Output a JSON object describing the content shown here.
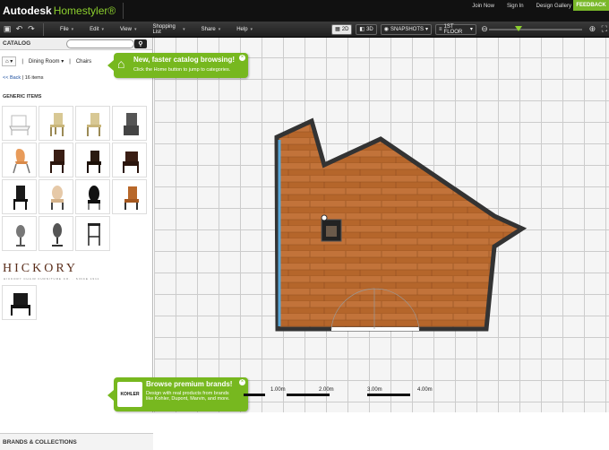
{
  "app": {
    "brand": "Autodesk",
    "brand_sub": "Homestyler®"
  },
  "toplinks": [
    "Join Now",
    "Sign In",
    "Design Gallery"
  ],
  "feedback": "FEEDBACK",
  "menu": [
    "File",
    "Edit",
    "View",
    "Shopping List",
    "Share",
    "Help"
  ],
  "view": {
    "view2d": "2D",
    "view3d": "3D",
    "snapshots": "SNAPSHOTS",
    "floor": "1ST FLOOR"
  },
  "sidebar": {
    "title": "CATALOG",
    "search_placeholder": "",
    "crumbs": [
      "Dining Room",
      "Chairs"
    ],
    "back": "<< Back",
    "count": "16 items",
    "section": "GENERIC ITEMS",
    "brand": "HICKORY",
    "brand_sub": "HICKORY CHAIR FURNITURE CO. · SINCE 1911",
    "footer": "BRANDS & COLLECTIONS"
  },
  "tip1": {
    "title": "New, faster catalog browsing!",
    "body": "Click the Home button to jump to categories."
  },
  "tip2": {
    "logo": "KOHLER",
    "title": "Browse premium brands!",
    "body": "Design with real products from brands like Kohler, Dupont, Marvin, and more."
  },
  "scale": [
    "1.00m",
    "2.00m",
    "3.00m",
    "4.00m"
  ],
  "colors": {
    "accent": "#77b81f",
    "topbar": "#111111",
    "floor": "#b5662b",
    "wall": "#333333"
  }
}
